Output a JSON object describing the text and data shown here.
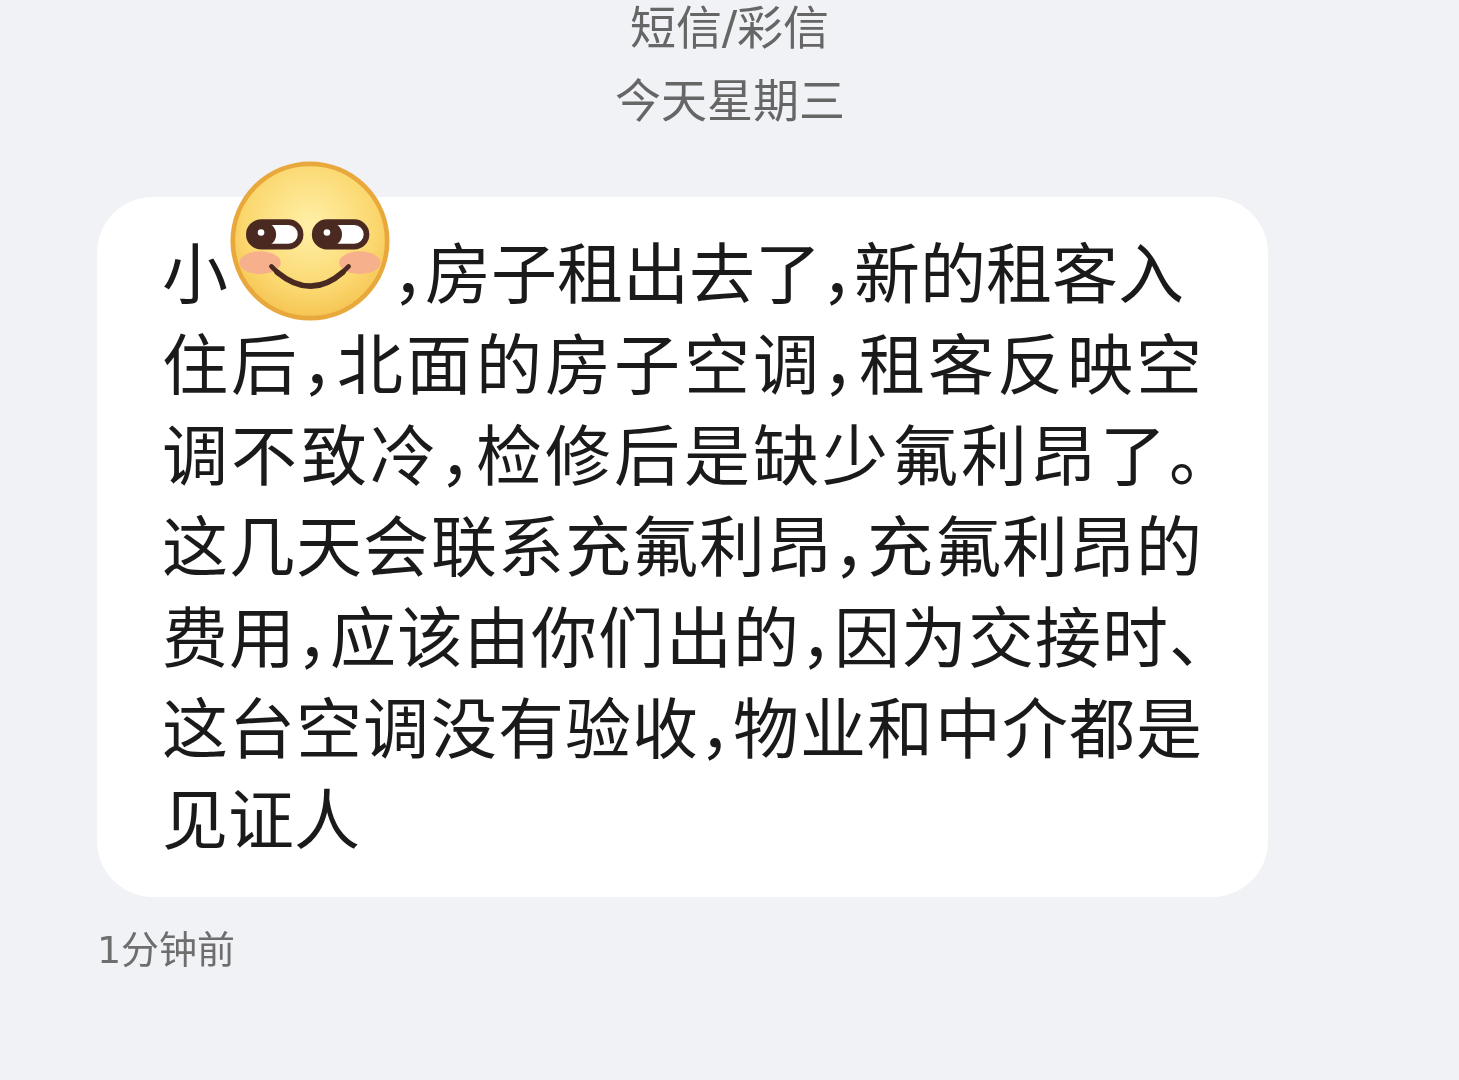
{
  "header": {
    "title": "短信/彩信",
    "date": "今天星期三"
  },
  "message": {
    "first_line": [
      "小",
      "，房子租出去了，新的租客入"
    ],
    "body": "住后，北面的房子空调，租客反映空调不致冷，检修后是缺少氟利昂了。这几天会联系充氟利昂，充氟利昂的费用，应该由你们出的，因为交接时、这台空调没有验收，物业和中介都是见证人",
    "time": "1分钟前"
  }
}
